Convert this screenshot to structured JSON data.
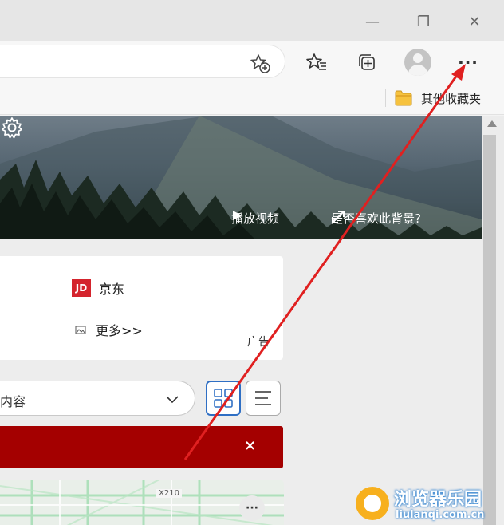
{
  "window": {
    "minimize_glyph": "—",
    "maximize_glyph": "❐",
    "close_glyph": "✕"
  },
  "toolbar": {
    "add_favorite_icon": "star-plus-icon",
    "favorites_icon": "favorites-list-icon",
    "collections_icon": "collections-icon",
    "profile_icon": "profile-avatar-icon",
    "more_label": "···"
  },
  "favorites_bar": {
    "other_favorites_label": "其他收藏夹"
  },
  "hero": {
    "settings_icon": "gear-icon",
    "play_video_label": "播放视频",
    "like_background_label": "是否喜欢此背景?"
  },
  "quick_links": {
    "jd_logo_text": "JD",
    "jd_label": "京东",
    "more_label": "更多>>",
    "ad_label": "广告"
  },
  "feed": {
    "select_text": "内容",
    "grid_view_icon": "grid-view-icon",
    "list_view_icon": "list-view-icon"
  },
  "banner": {
    "close_glyph": "×",
    "color": "#a40000"
  },
  "map": {
    "road_label": "X210",
    "more_glyph": "···"
  },
  "watermark": {
    "title": "浏览器乐园",
    "url": "liulanqi.com.cn",
    "color": "#f7b01e"
  },
  "annotation": {
    "arrow_color": "#e02020"
  }
}
